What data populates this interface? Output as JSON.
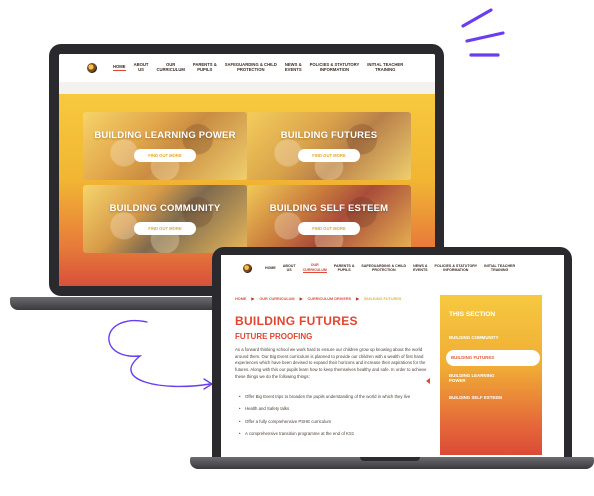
{
  "colors": {
    "accent_red": "#e3452f",
    "accent_yellow": "#f6c940",
    "purple_decor": "#6a3df0",
    "device_dark": "#2a2a2e"
  },
  "icons": [
    "school-logo-icon",
    "sparkle-lines-icon",
    "curly-arrow-icon",
    "nav-arrow-icon"
  ],
  "back_site": {
    "nav": [
      {
        "label": "HOME"
      },
      {
        "label": "ABOUT\nUS"
      },
      {
        "label": "OUR\nCURRICULUM"
      },
      {
        "label": "PARENTS &\nPUPILS"
      },
      {
        "label": "SAFEGUARDING & CHILD\nPROTECTION"
      },
      {
        "label": "NEWS &\nEVENTS"
      },
      {
        "label": "POLICIES & STATUTORY\nINFORMATION"
      },
      {
        "label": "INITIAL TEACHER\nTRAINING"
      }
    ],
    "tiles": [
      {
        "title": "BUILDING LEARNING POWER",
        "button": "FIND OUT MORE"
      },
      {
        "title": "BUILDING FUTURES",
        "button": "FIND OUT MORE"
      },
      {
        "title": "BUILDING COMMUNITY",
        "button": "FIND OUT MORE"
      },
      {
        "title": "BUILDING SELF ESTEEM",
        "button": "FIND OUT MORE"
      }
    ]
  },
  "front_site": {
    "nav": [
      {
        "label": "HOME"
      },
      {
        "label": "ABOUT\nUS"
      },
      {
        "label": "OUR\nCURRICULUM"
      },
      {
        "label": "PARENTS &\nPUPILS"
      },
      {
        "label": "SAFEGUARDING & CHILD\nPROTECTION"
      },
      {
        "label": "NEWS &\nEVENTS"
      },
      {
        "label": "POLICIES & STATUTORY\nINFORMATION"
      },
      {
        "label": "INITIAL TEACHER\nTRAINING"
      }
    ],
    "breadcrumb": [
      "HOME",
      "OUR CURRICULUM",
      "CURRICULUM DRIVERS",
      "BUILDING FUTURES"
    ],
    "page_title": "BUILDING FUTURES",
    "sub_title": "FUTURE PROOFING",
    "intro": "As a forward thinking school we work hard to ensure our children grow up knowing about the world around them. Our Big Event curriculum is planned to provide our children with a wealth of first hand experiences which have been devised to expand their horizons and increase their aspirations for the futures. Along with this our pupils learn how to keep themselves healthy and safe. In order to achieve these things we do the following things:",
    "bullets": [
      "Offer Big Event trips to broaden the pupils understanding of the world in which they live",
      "Health and Safety talks",
      "Offer a fully comprehensive PSHE curriculum",
      "A comprehensive transition programme at the end of KS1"
    ],
    "sidebar": {
      "heading": "THIS SECTION",
      "items": [
        {
          "label": "BUILDING COMMUNITY"
        },
        {
          "label": "BUILDING FUTURES"
        },
        {
          "label": "BUILDING LEARNING\nPOWER"
        },
        {
          "label": "BUILDING SELF ESTEEM"
        }
      ]
    }
  }
}
